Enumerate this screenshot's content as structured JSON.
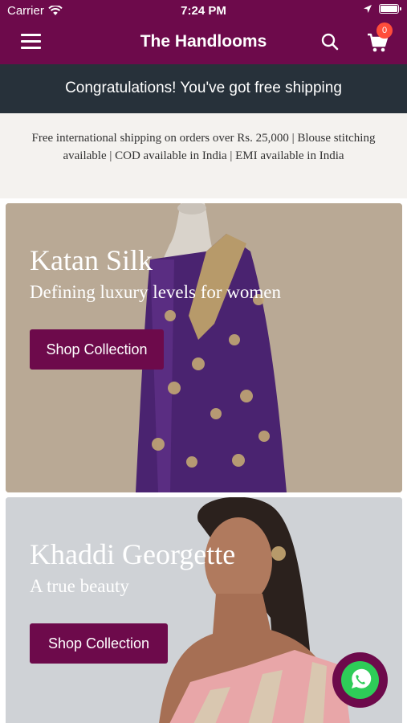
{
  "status_bar": {
    "carrier": "Carrier",
    "time": "7:24 PM"
  },
  "header": {
    "title": "The Handlooms",
    "cart_count": "0",
    "icons": [
      "menu-icon",
      "search-icon",
      "cart-icon"
    ]
  },
  "shipping_banner": "Congratulations! You've got free shipping",
  "announcement": "Free international shipping on orders over Rs. 25,000 | Blouse stitching available | COD available in India | EMI available in India",
  "collections": [
    {
      "title": "Katan Silk",
      "subtitle": "Defining luxury levels for women",
      "button": "Shop Collection"
    },
    {
      "title": "Khaddi Georgette",
      "subtitle": "A true beauty",
      "button": "Shop Collection"
    }
  ],
  "colors": {
    "brand": "#6d0a4b",
    "banner": "#27313a",
    "badge": "#ff4d3b",
    "whatsapp": "#2ecc58"
  }
}
